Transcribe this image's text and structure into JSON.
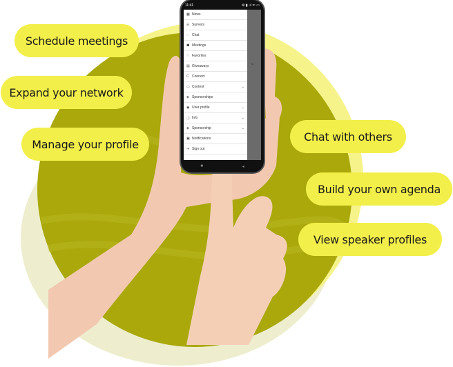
{
  "features": {
    "left": [
      {
        "label": "Schedule meetings"
      },
      {
        "label": "Expand your network"
      },
      {
        "label": "Manage your profile"
      }
    ],
    "right": [
      {
        "label": "Chat with others"
      },
      {
        "label": "Build your own agenda"
      },
      {
        "label": "View speaker profiles"
      }
    ]
  },
  "phone": {
    "status_time": "11:41",
    "status_icons": "⚙ ▮ .ıl ᯤ ▭",
    "side_text": "fo",
    "menu": [
      {
        "icon": "newspaper-icon",
        "glyph": "▦",
        "label": "News",
        "chevron": false
      },
      {
        "icon": "survey-icon",
        "glyph": "☷",
        "label": "Surveys",
        "chevron": false
      },
      {
        "icon": "chat-icon",
        "glyph": "◌",
        "label": "Chat",
        "chevron": false
      },
      {
        "icon": "meetings-icon",
        "glyph": "☗",
        "label": "Meetings",
        "chevron": false
      },
      {
        "icon": "heart-icon",
        "glyph": "♡",
        "label": "Favorites",
        "chevron": false
      },
      {
        "icon": "gift-icon",
        "glyph": "▤",
        "label": "Giveaways",
        "chevron": false
      },
      {
        "icon": "connect-icon",
        "glyph": "C",
        "label": "Connect",
        "chevron": false
      },
      {
        "icon": "content-icon",
        "glyph": "▭",
        "label": "Content",
        "chevron": true
      },
      {
        "icon": "sponsorships-icon",
        "glyph": "◈",
        "label": "Sponsorships",
        "chevron": false
      },
      {
        "icon": "user-profile-icon",
        "glyph": "◉",
        "label": "User profile",
        "chevron": true
      },
      {
        "icon": "info-icon",
        "glyph": "ⓘ",
        "label": "Info",
        "chevron": true
      },
      {
        "icon": "sponsorship-icon",
        "glyph": "◈",
        "label": "Sponsorship",
        "chevron": true
      },
      {
        "icon": "notifications-icon",
        "glyph": "▣",
        "label": "Notifications",
        "chevron": false
      },
      {
        "icon": "sign-out-icon",
        "glyph": "⇥",
        "label": "Sign out",
        "chevron": false
      }
    ],
    "chevron_glyph": "⌄",
    "nav": {
      "home": "■",
      "back": "◂"
    }
  },
  "colors": {
    "pill": "#f3ef4a",
    "circle_dark": "#aaa80a",
    "circle_light": "#f5f38a",
    "circle_pale": "#eeeecf"
  }
}
